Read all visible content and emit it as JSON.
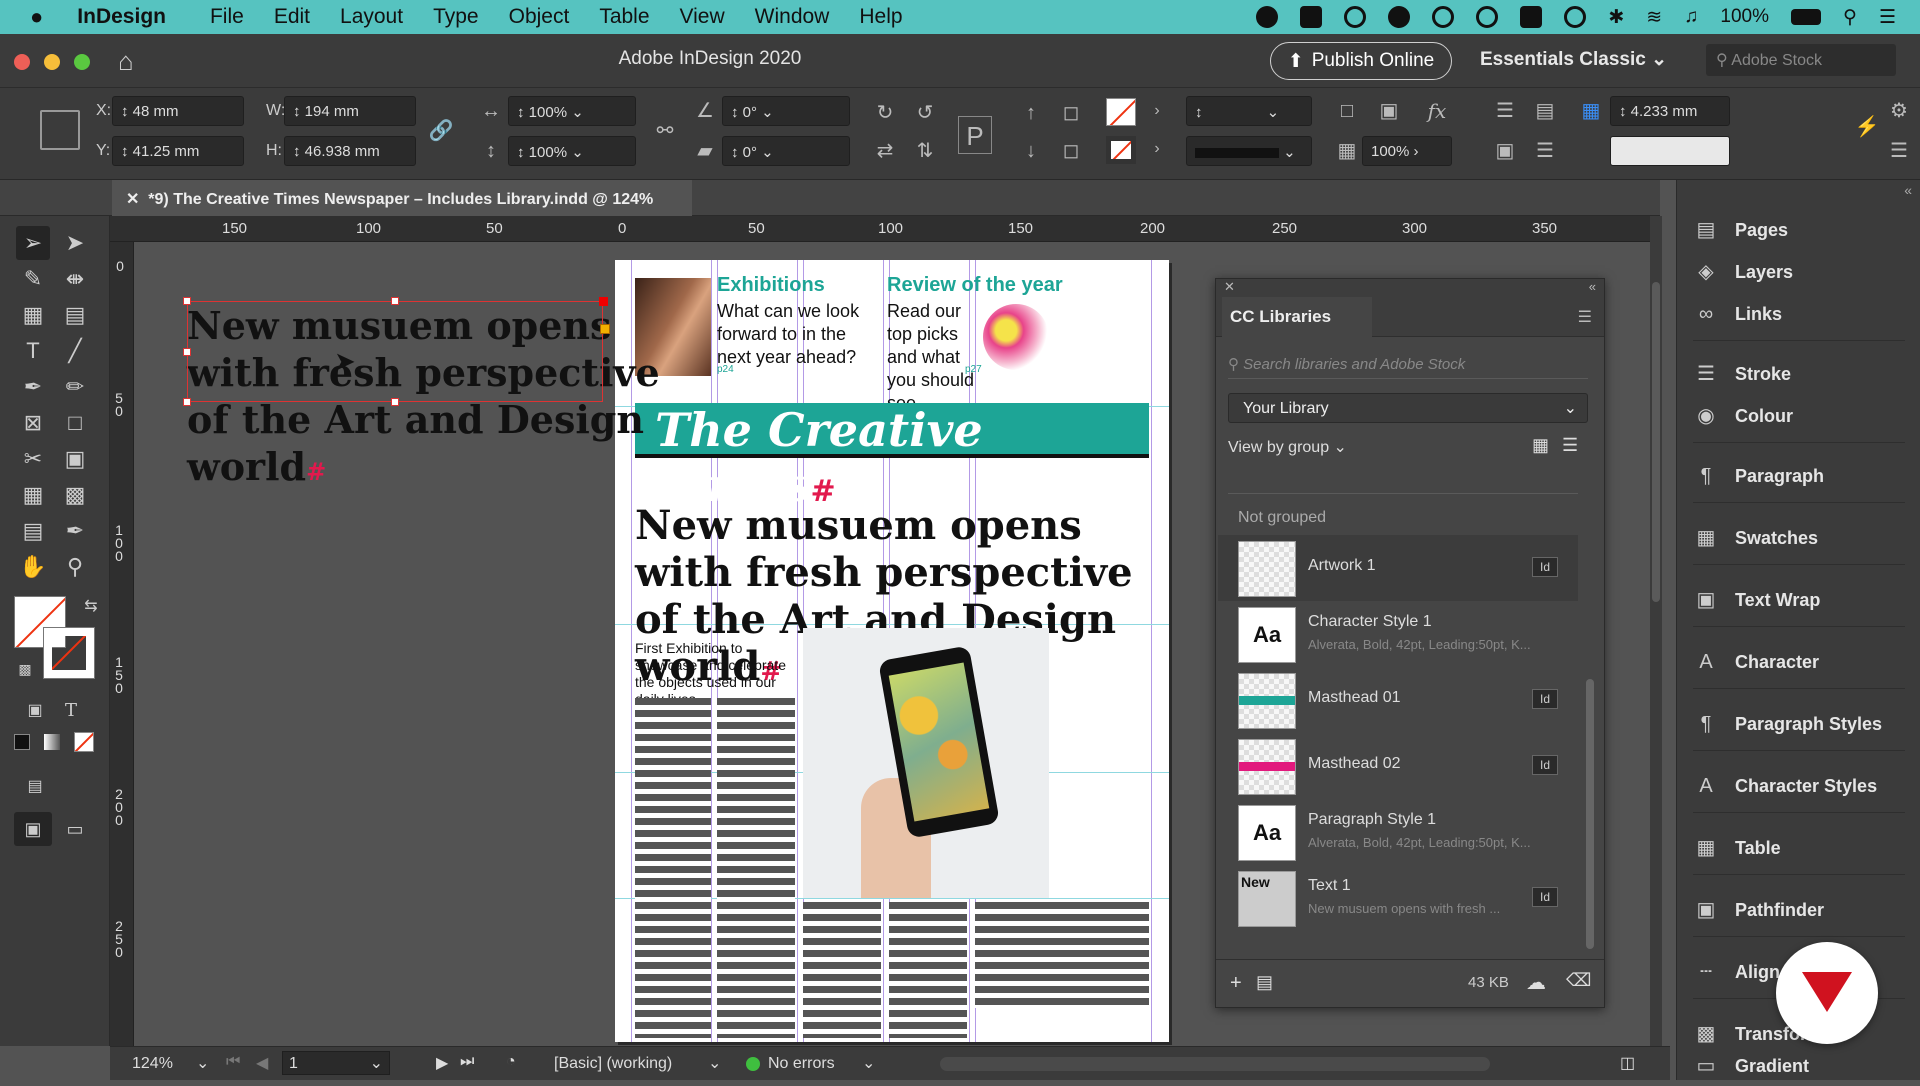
{
  "menubar": {
    "apple": "",
    "app": "InDesign",
    "items": [
      "File",
      "Edit",
      "Layout",
      "Type",
      "Object",
      "Table",
      "View",
      "Window",
      "Help"
    ],
    "battery": "100%"
  },
  "titlebar": {
    "title": "Adobe InDesign 2020",
    "publish": "Publish Online",
    "workspace": "Essentials Classic",
    "stock_placeholder": "Adobe Stock"
  },
  "control": {
    "x_label": "X:",
    "x": "48 mm",
    "y_label": "Y:",
    "y": "41.25 mm",
    "w_label": "W:",
    "w": "194 mm",
    "h_label": "H:",
    "h": "46.938 mm",
    "scale_x": "100%",
    "scale_y": "100%",
    "rotate": "0°",
    "shear": "0°",
    "stroke_pct": "100%",
    "offset": "4.233 mm"
  },
  "doc_tab": {
    "label": "*9) The Creative Times Newspaper – Includes Library.indd @ 124%"
  },
  "ruler": {
    "h": [
      "150",
      "100",
      "50",
      "0",
      "50",
      "100",
      "150",
      "200",
      "250",
      "300",
      "350"
    ],
    "v": [
      "0",
      "50",
      "100",
      "150",
      "200",
      "250"
    ]
  },
  "page": {
    "headline": "New musuem opens with fresh perspective of the Art and Design world",
    "paste_headline": "New musuem opens with fresh perspective of the Art and Design world",
    "masthead": "The Creative Times",
    "exhibitions_title": "Exhibitions",
    "exhibitions_body": "What can we look forward to in the next year ahead?",
    "review_title": "Review of the year",
    "review_body": "Read our top picks and what you should see",
    "p24": "p24",
    "p27": "p27",
    "subhead": "First Exhibition to showcase and celebrate the objects used in our daily lives"
  },
  "status": {
    "zoom": "124%",
    "page": "1",
    "style": "[Basic] (working)",
    "errors": "No errors"
  },
  "cclib": {
    "title": "CC Libraries",
    "search_placeholder": "Search libraries and Adobe Stock",
    "library": "Your Library",
    "view": "View by group",
    "group": "Not grouped",
    "items": [
      {
        "name": "Artwork 1",
        "sub": "",
        "badge": "Id",
        "thumb": ""
      },
      {
        "name": "Character Style 1",
        "sub": "Alverata, Bold, 42pt, Leading:50pt, K...",
        "badge": "",
        "thumb": "Aa"
      },
      {
        "name": "Masthead 01",
        "sub": "",
        "badge": "Id",
        "thumb": ""
      },
      {
        "name": "Masthead 02",
        "sub": "",
        "badge": "Id",
        "thumb": ""
      },
      {
        "name": "Paragraph Style 1",
        "sub": "Alverata, Bold, 42pt, Leading:50pt, K...",
        "badge": "",
        "thumb": "Aa"
      },
      {
        "name": "Text 1",
        "sub": "New musuem opens with fresh ...",
        "badge": "Id",
        "thumb": "New"
      }
    ],
    "size": "43 KB"
  },
  "dock": {
    "items": [
      "Pages",
      "Layers",
      "Links",
      "Stroke",
      "Colour",
      "Paragraph",
      "Swatches",
      "Text Wrap",
      "Character",
      "Paragraph Styles",
      "Character Styles",
      "Table",
      "Pathfinder",
      "Align",
      "Transform",
      "Gradient"
    ]
  },
  "colors": {
    "accent": "#1da596",
    "menubar": "#56c3c0",
    "brand": "#e2194d"
  }
}
